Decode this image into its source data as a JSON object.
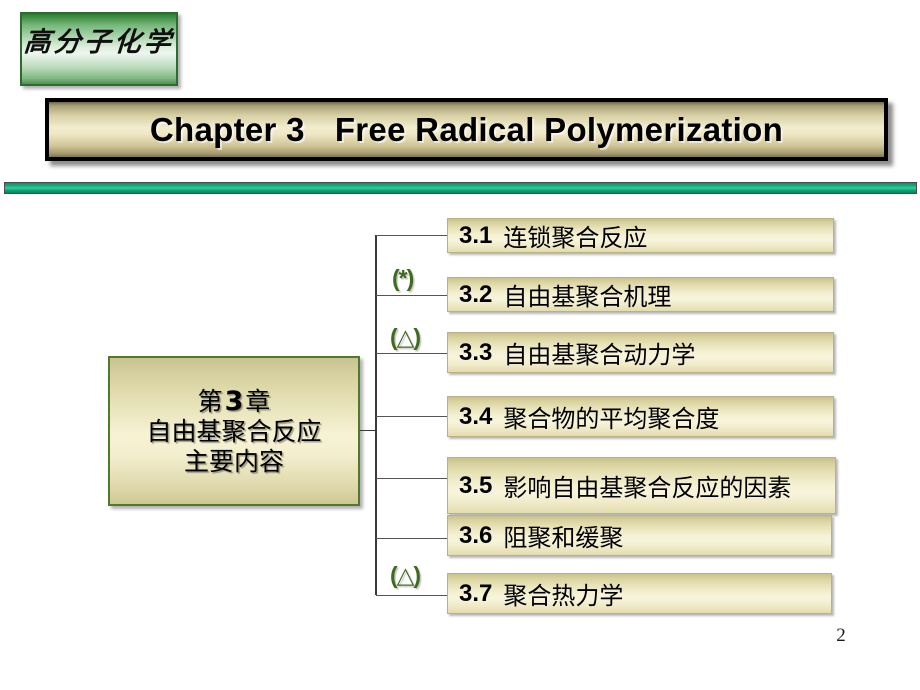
{
  "slide": {
    "page_number": "2",
    "course_badge": "高分子化学",
    "title": {
      "chapter": "Chapter 3",
      "subject": "Free Radical Polymerization"
    },
    "root_node": {
      "line1_prefix": "第",
      "line1_number": "3",
      "line1_suffix": "章",
      "line2": "自由基聚合反应",
      "line3": "主要内容"
    },
    "items": [
      {
        "number": "3.1",
        "label": "连锁聚合反应",
        "marker": ""
      },
      {
        "number": "3.2",
        "label": "自由基聚合机理",
        "marker": "(*)"
      },
      {
        "number": "3.3",
        "label": "自由基聚合动力学",
        "marker": "(△)"
      },
      {
        "number": "3.4",
        "label": "聚合物的平均聚合度",
        "marker": ""
      },
      {
        "number": "3.5",
        "label": "影响自由基聚合反应的因素",
        "marker": ""
      },
      {
        "number": "3.6",
        "label": "阻聚和缓聚",
        "marker": ""
      },
      {
        "number": "3.7",
        "label": "聚合热力学",
        "marker": "(△)"
      }
    ],
    "colors": {
      "badge_green": "#2e7d32",
      "banner_gold": "#f2ecd0",
      "divider_green": "#18b07f",
      "box_border_green": "#4f7a2a",
      "marker_green": "#3f6b1e"
    }
  }
}
